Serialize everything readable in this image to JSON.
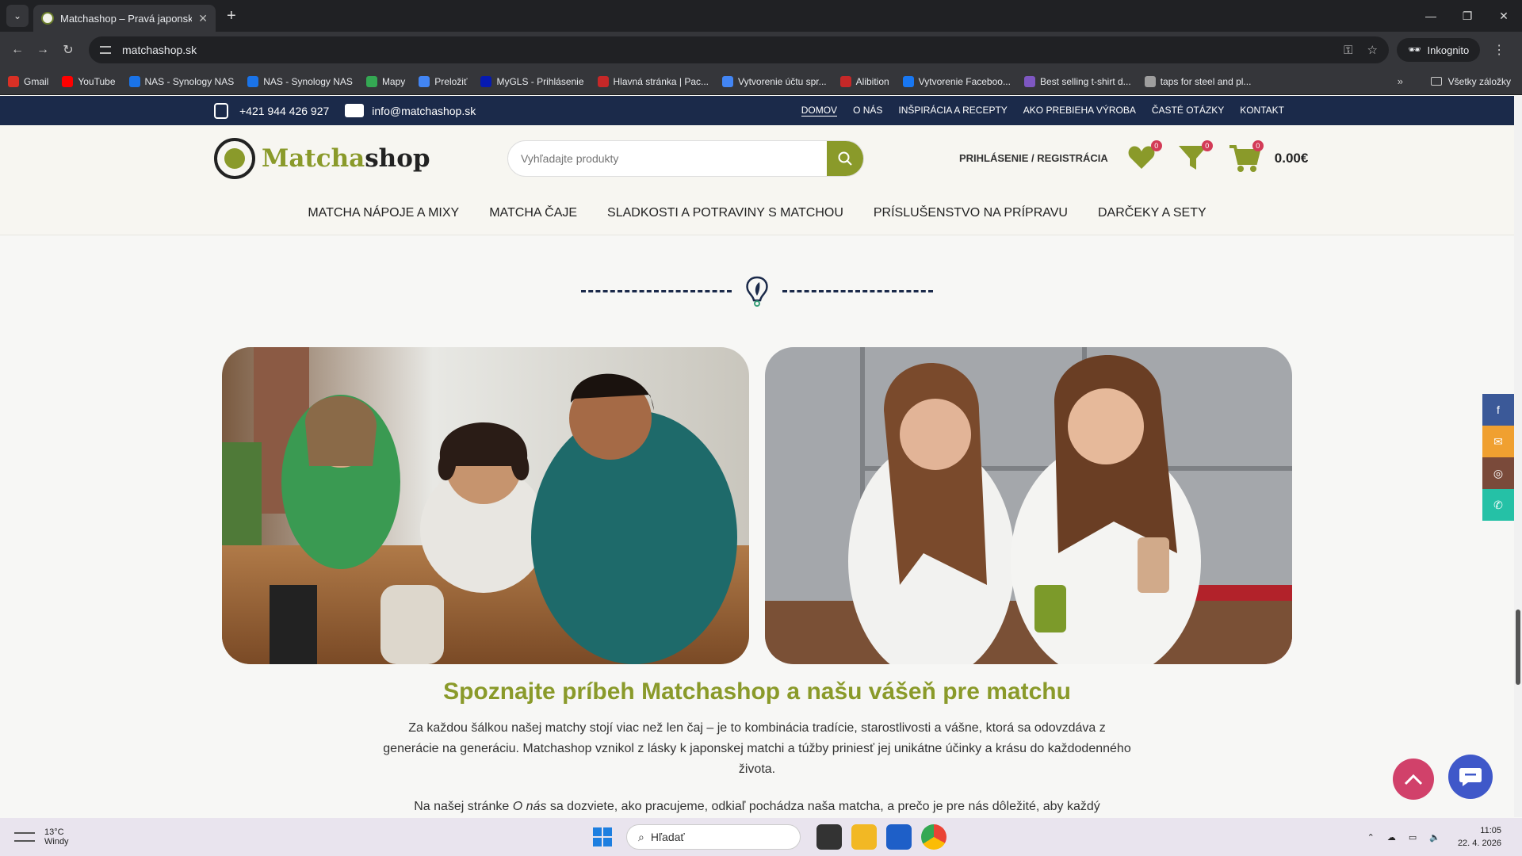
{
  "browser": {
    "tab_title": "Matchashop – Pravá japonská m",
    "url": "matchashop.sk",
    "incognito_label": "Inkognito",
    "bookmarks": [
      {
        "label": "Gmail",
        "color": "#d93025"
      },
      {
        "label": "YouTube",
        "color": "#ff0000"
      },
      {
        "label": "NAS - Synology NAS",
        "color": "#1a73e8"
      },
      {
        "label": "NAS - Synology NAS",
        "color": "#1a73e8"
      },
      {
        "label": "Mapy",
        "color": "#34a853"
      },
      {
        "label": "Preložiť",
        "color": "#4285f4"
      },
      {
        "label": "MyGLS - Prihlásenie",
        "color": "#061ab1"
      },
      {
        "label": "Hlavná stránka | Pac...",
        "color": "#c62828"
      },
      {
        "label": "Vytvorenie účtu spr...",
        "color": "#4285f4"
      },
      {
        "label": "Alibition",
        "color": "#c62828"
      },
      {
        "label": "Vytvorenie Faceboo...",
        "color": "#1877f2"
      },
      {
        "label": "Best selling t-shirt d...",
        "color": "#7e57c2"
      },
      {
        "label": "taps for steel and pl...",
        "color": "#9e9e9e"
      }
    ],
    "all_bookmarks_label": "Všetky záložky"
  },
  "site": {
    "topbar": {
      "phone": "+421 944 426 927",
      "email": "info@matchashop.sk",
      "links": [
        "DOMOV",
        "O NÁS",
        "INŠPIRÁCIA A RECEPTY",
        "AKO PREBIEHA VÝROBA",
        "ČASTÉ OTÁZKY",
        "KONTAKT"
      ]
    },
    "logo": {
      "part1": "Matcha",
      "part2": "shop"
    },
    "search_placeholder": "Vyhľadajte produkty",
    "login_label": "PRIHLÁSENIE / REGISTRÁCIA",
    "wishlist_count": "0",
    "compare_count": "0",
    "cart_count": "0",
    "cart_total": "0.00€",
    "main_nav": [
      "MATCHA NÁPOJE A MIXY",
      "MATCHA ČAJE",
      "SLADKOSTI A POTRAVINY S MATCHOU",
      "PRÍSLUŠENSTVO NA PRÍPRAVU",
      "DARČEKY A SETY"
    ],
    "about_title": "Spoznajte príbeh Matchashop a našu vášeň pre matchu",
    "about_p1": "Za každou šálkou našej matchy stojí viac než len čaj – je to kombinácia tradície, starostlivosti a vášne, ktorá sa odovzdáva z generácie na generáciu. Matchashop vznikol z lásky k japonskej matchi a túžby priniesť jej unikátne účinky a krásu do každodenného života.",
    "about_p2_a": "Na našej stránke ",
    "about_p2_em": "O nás",
    "about_p2_b": " sa dozviete, ako pracujeme, odkiaľ pochádza naša matcha, a prečo je pre nás dôležité, aby každý"
  },
  "social_colors": {
    "facebook": "#3b5998",
    "email": "#f0a030",
    "instagram": "#7a4a3a",
    "whatsapp": "#25c1a6"
  },
  "taskbar": {
    "temp": "13°C",
    "weather": "Windy",
    "search_placeholder": "Hľadať",
    "time": "11:05",
    "date": "22. 4. 2026"
  }
}
